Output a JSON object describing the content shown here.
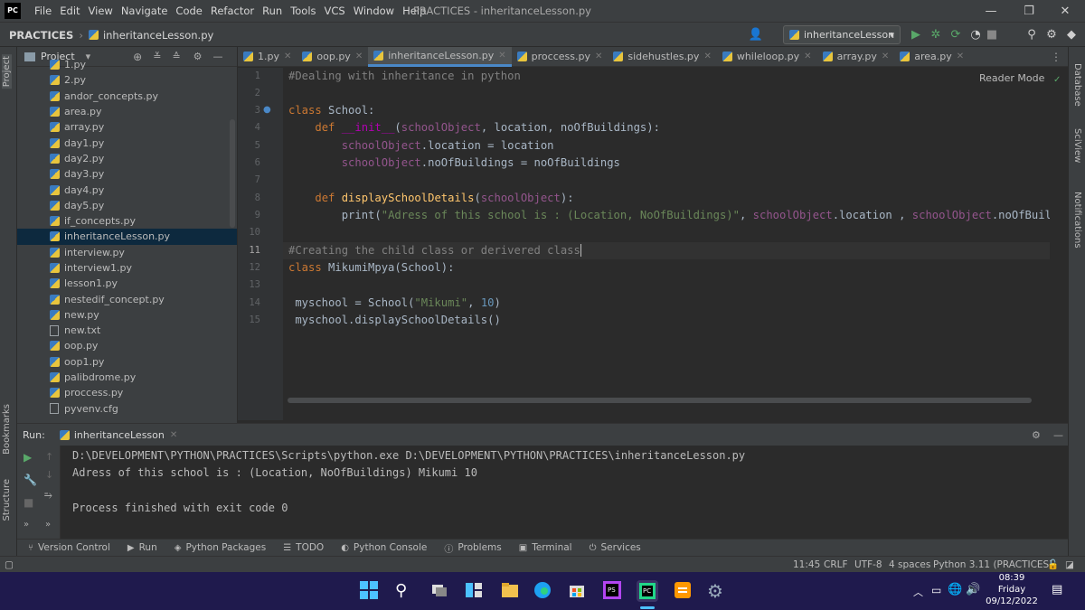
{
  "menu": {
    "logo": "PC",
    "items": [
      "File",
      "Edit",
      "View",
      "Navigate",
      "Code",
      "Refactor",
      "Run",
      "Tools",
      "VCS",
      "Window",
      "Help"
    ],
    "window_title": "PRACTICES - inheritanceLesson.py"
  },
  "navbar": {
    "project": "PRACTICES",
    "file": "inheritanceLesson.py",
    "run_config": "inheritanceLesson"
  },
  "project_panel": {
    "title": "Project",
    "files": [
      {
        "name": "1.py",
        "type": "py"
      },
      {
        "name": "2.py",
        "type": "py"
      },
      {
        "name": "andor_concepts.py",
        "type": "py"
      },
      {
        "name": "area.py",
        "type": "py"
      },
      {
        "name": "array.py",
        "type": "py"
      },
      {
        "name": "day1.py",
        "type": "py"
      },
      {
        "name": "day2.py",
        "type": "py"
      },
      {
        "name": "day3.py",
        "type": "py"
      },
      {
        "name": "day4.py",
        "type": "py"
      },
      {
        "name": "day5.py",
        "type": "py"
      },
      {
        "name": "if_concepts.py",
        "type": "py"
      },
      {
        "name": "inheritanceLesson.py",
        "type": "py",
        "selected": true
      },
      {
        "name": "interview.py",
        "type": "py"
      },
      {
        "name": "interview1.py",
        "type": "py"
      },
      {
        "name": "lesson1.py",
        "type": "py"
      },
      {
        "name": "nestedif_concept.py",
        "type": "py"
      },
      {
        "name": "new.py",
        "type": "py"
      },
      {
        "name": "new.txt",
        "type": "txt"
      },
      {
        "name": "oop.py",
        "type": "py"
      },
      {
        "name": "oop1.py",
        "type": "py"
      },
      {
        "name": "palibdrome.py",
        "type": "py"
      },
      {
        "name": "proccess.py",
        "type": "py"
      },
      {
        "name": "pyvenv.cfg",
        "type": "txt"
      }
    ]
  },
  "tabs": [
    {
      "label": "1.py",
      "active": false
    },
    {
      "label": "oop.py",
      "active": false
    },
    {
      "label": "inheritanceLesson.py",
      "active": true
    },
    {
      "label": "proccess.py",
      "active": false
    },
    {
      "label": "sidehustles.py",
      "active": false
    },
    {
      "label": "whileloop.py",
      "active": false
    },
    {
      "label": "array.py",
      "active": false
    },
    {
      "label": "area.py",
      "active": false
    }
  ],
  "editor": {
    "reader_mode": "Reader Mode",
    "line_numbers": [
      "1",
      "2",
      "3",
      "4",
      "5",
      "6",
      "7",
      "8",
      "9",
      "10",
      "11",
      "12",
      "13",
      "14",
      "15"
    ],
    "current_line": 11
  },
  "right_strip": {
    "tabs": [
      "Database",
      "SciView",
      "Notifications"
    ]
  },
  "left_strip": {
    "tabs": [
      "Project",
      "Bookmarks",
      "Structure"
    ]
  },
  "run_panel": {
    "label": "Run:",
    "tab": "inheritanceLesson",
    "output": [
      "D:\\DEVELOPMENT\\PYTHON\\PRACTICES\\Scripts\\python.exe D:\\DEVELOPMENT\\PYTHON\\PRACTICES\\inheritanceLesson.py",
      "Adress of this school is : (Location, NoOfBuildings) Mikumi 10",
      "",
      "Process finished with exit code 0"
    ]
  },
  "bottom_tabs": [
    "Version Control",
    "Run",
    "Python Packages",
    "TODO",
    "Python Console",
    "Problems",
    "Terminal",
    "Services"
  ],
  "status": {
    "position": "11:45",
    "line_sep": "CRLF",
    "encoding": "UTF-8",
    "indent": "4 spaces",
    "interpreter": "Python 3.11 (PRACTICES)"
  },
  "taskbar": {
    "time": "08:39",
    "day": "Friday",
    "date": "09/12/2022"
  }
}
